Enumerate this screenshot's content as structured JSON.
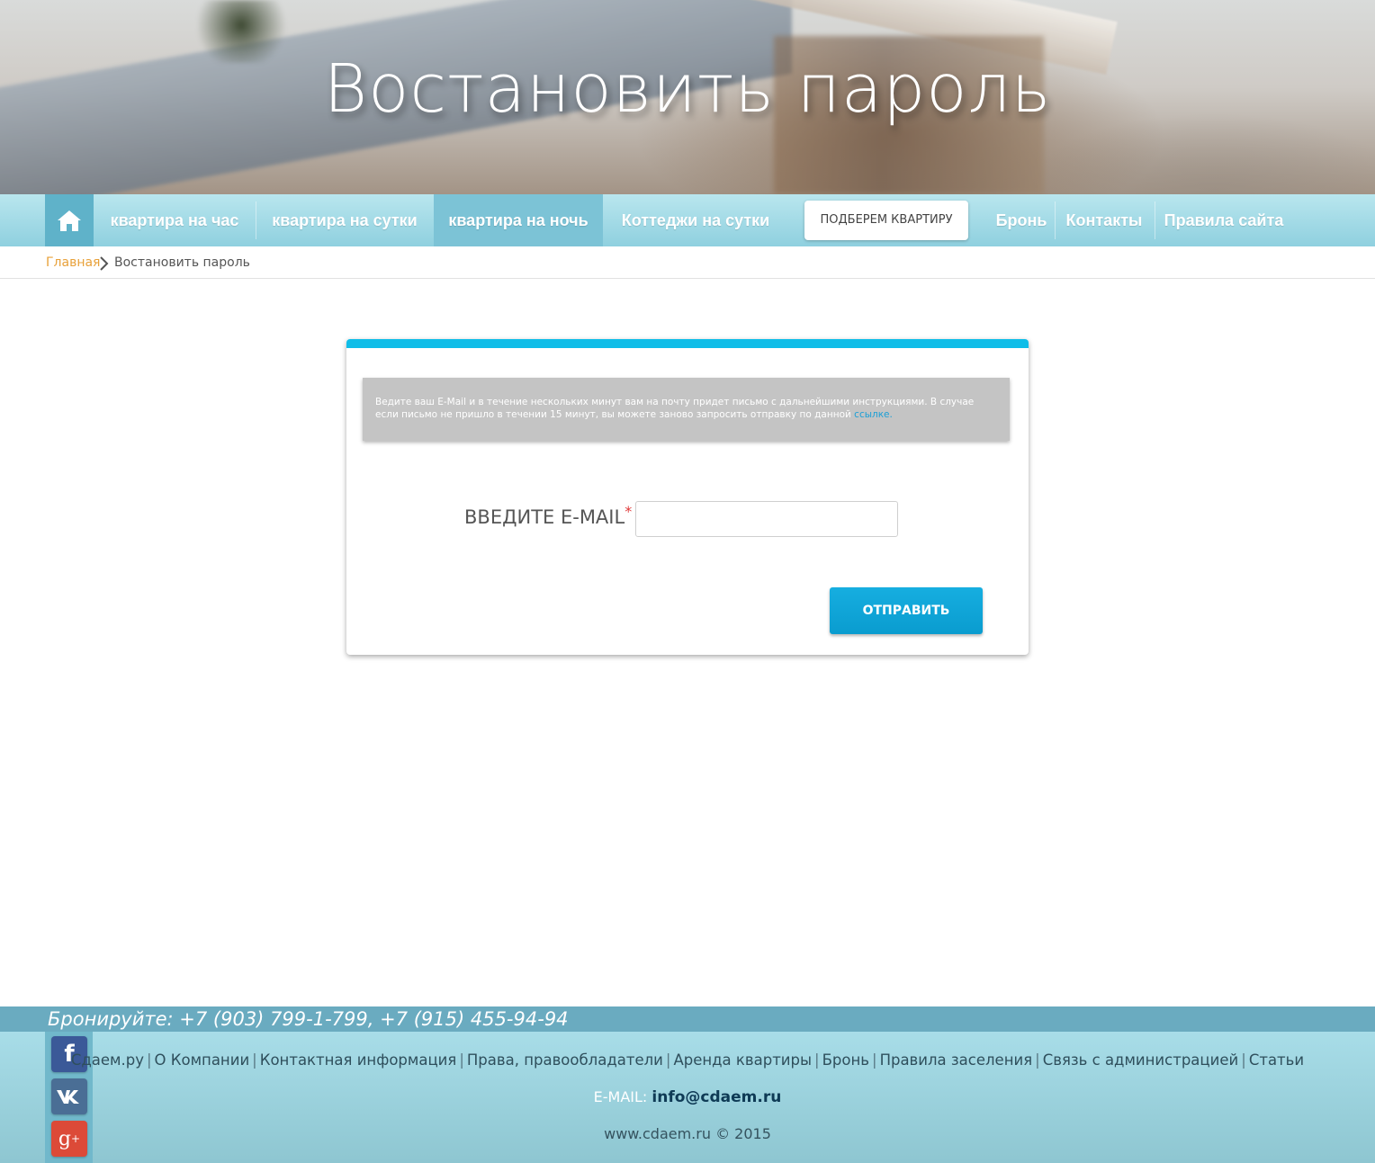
{
  "hero": {
    "title": "Востановить пароль"
  },
  "nav": {
    "home_icon": "home-icon",
    "items": [
      {
        "label": "квартира на час"
      },
      {
        "label": "квартира на сутки"
      },
      {
        "label": "квартира на ночь",
        "active": true
      },
      {
        "label": "Коттеджи на сутки"
      }
    ],
    "pick_button": "ПОДБЕРЕМ КВАРТИРУ",
    "right_items": [
      {
        "label": "Бронь"
      },
      {
        "label": "Контакты"
      },
      {
        "label": "Правила сайта"
      }
    ]
  },
  "breadcrumb": {
    "home": "Главная",
    "separator_icon": "chevron-right-icon",
    "current": "Востановить пароль"
  },
  "form": {
    "notice_text": "Ведите ваш E-Mail и в течение  нескольких минут вам на почту придет письмо с дальнейшими инструкциями. В случае если письмо не пришло в течении 15 минут, вы можете заново запросить отправку по данной",
    "notice_link": "ссылке.",
    "email_label": "ВВЕДИТЕ E-MAIL",
    "required_mark": "*",
    "email_value": "",
    "email_placeholder": "",
    "submit_label": "ОТПРАВИТЬ"
  },
  "footer": {
    "phone_line": "Бронируйте: +7 (903) 799-1-799, +7 (915) 455-94-94",
    "social": [
      "facebook-icon",
      "vk-icon",
      "google-plus-icon"
    ],
    "links": [
      "Сдаем.ру",
      "О Компании",
      "Контактная информация",
      "Права, правообладатели",
      "Аренда квартиры",
      "Бронь",
      "Правила заселения",
      "Связь с администрацией",
      "Статьи"
    ],
    "link_separator": "|",
    "email_label": "E-MAIL:",
    "email": "info@cdaem.ru",
    "copyright": "www.cdaem.ru © 2015"
  },
  "colors": {
    "accent": "#0fbde8",
    "nav_bg": "#9fd9e6",
    "nav_active": "#7cc3d6",
    "breadcrumb_link": "#e8a13a",
    "required": "#e03a3a",
    "footer_bar": "#6aabc0"
  }
}
